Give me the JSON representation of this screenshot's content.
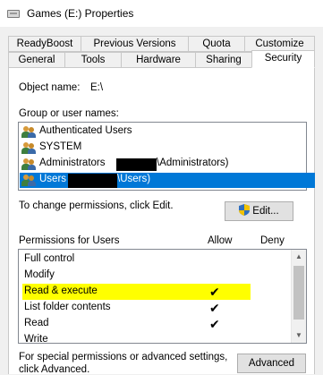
{
  "window": {
    "title": "Games (E:) Properties"
  },
  "tabs_row1": [
    "ReadyBoost",
    "Previous Versions",
    "Quota",
    "Customize"
  ],
  "tabs_row2": [
    "General",
    "Tools",
    "Hardware",
    "Sharing",
    "Security"
  ],
  "object": {
    "label": "Object name:",
    "value": "E:\\"
  },
  "group_label": "Group or user names:",
  "users": [
    {
      "text": "Authenticated Users"
    },
    {
      "text": "SYSTEM"
    },
    {
      "text": "Administrators",
      "suffix": "\\Administrators)"
    },
    {
      "text": "Users",
      "suffix": "\\Users)"
    }
  ],
  "change_text": "To change permissions, click Edit.",
  "edit_button": "Edit...",
  "permissions": {
    "header": "Permissions for Users",
    "allow_header": "Allow",
    "deny_header": "Deny",
    "rows": [
      {
        "name": "Full control",
        "allow": "",
        "deny": ""
      },
      {
        "name": "Modify",
        "allow": "",
        "deny": ""
      },
      {
        "name": "Read & execute",
        "allow": "✔",
        "deny": ""
      },
      {
        "name": "List folder contents",
        "allow": "✔",
        "deny": ""
      },
      {
        "name": "Read",
        "allow": "✔",
        "deny": ""
      },
      {
        "name": "Write",
        "allow": "",
        "deny": ""
      }
    ]
  },
  "footer": {
    "line1": "For special permissions or advanced settings,",
    "line2": "click Advanced.",
    "advanced_button": "Advanced"
  },
  "colors": {
    "selection": "#0078d7",
    "highlight": "#ffff00"
  },
  "icons": {
    "title": "drive-icon",
    "user": "users-group-icon",
    "edit": "uac-shield-icon"
  }
}
